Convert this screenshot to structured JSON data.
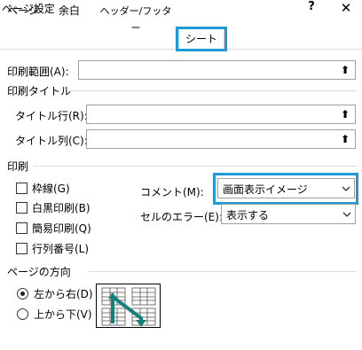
{
  "window": {
    "title": "ページ設定",
    "help": "?",
    "close": "✕"
  },
  "tabs": [
    {
      "label": "ページ"
    },
    {
      "label": "余白"
    },
    {
      "label": "ヘッダー/フッター"
    },
    {
      "label": "シート",
      "active": true
    }
  ],
  "print_area": {
    "label": "印刷範囲(A):",
    "value": "",
    "button_glyph": "⬆"
  },
  "print_titles": {
    "heading": "印刷タイトル",
    "rows": {
      "label": "タイトル行(R):",
      "value": "",
      "button_glyph": "⬆"
    },
    "columns": {
      "label": "タイトル列(C):",
      "value": "",
      "button_glyph": "⬆"
    }
  },
  "print": {
    "heading": "印刷",
    "checkboxes": [
      {
        "label": "枠線(G)",
        "checked": false
      },
      {
        "label": "白黒印刷(B)",
        "checked": false
      },
      {
        "label": "簡易印刷(Q)",
        "checked": false
      },
      {
        "label": "行列番号(L)",
        "checked": false
      }
    ],
    "comments": {
      "label": "コメント(M):",
      "value": "画面表示イメージ"
    },
    "errors": {
      "label": "セルのエラー(E):",
      "value": "表示する"
    }
  },
  "page_order": {
    "heading": "ページの方向",
    "options": [
      {
        "label": "左から右(D)",
        "selected": true
      },
      {
        "label": "上から下(V)",
        "selected": false
      }
    ]
  },
  "icons": {
    "collapse": "collapse-dialog-icon",
    "dropdown": "chevron-down-icon",
    "preview": "page-order-preview-icon"
  },
  "colors": {
    "highlight": "#1e9ad6",
    "preview_arrow": "#15807a"
  }
}
